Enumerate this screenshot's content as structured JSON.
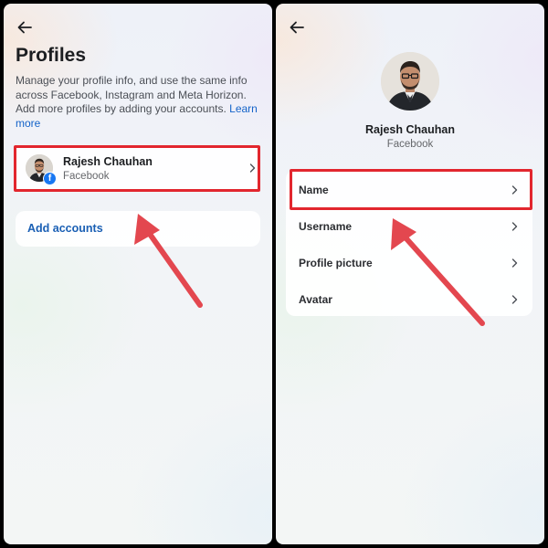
{
  "left_screen": {
    "title": "Profiles",
    "description": "Manage your profile info, and use the same info across Facebook, Instagram and Meta Horizon. Add more profiles by adding your accounts.",
    "learn_more": "Learn more",
    "profile": {
      "name": "Rajesh Chauhan",
      "platform": "Facebook",
      "badge_glyph": "f"
    },
    "add_accounts": "Add accounts"
  },
  "right_screen": {
    "name": "Rajesh Chauhan",
    "platform": "Facebook",
    "menu_items": [
      {
        "label": "Name"
      },
      {
        "label": "Username"
      },
      {
        "label": "Profile picture"
      },
      {
        "label": "Avatar"
      }
    ]
  },
  "icons": {
    "back": "back-arrow-icon",
    "chevron": "chevron-right-icon",
    "facebook_badge": "facebook-badge-icon"
  },
  "colors": {
    "highlight": "#e2262e",
    "arrow": "#e3474f",
    "link": "#1a5fb4",
    "facebook_blue": "#1877f2"
  }
}
